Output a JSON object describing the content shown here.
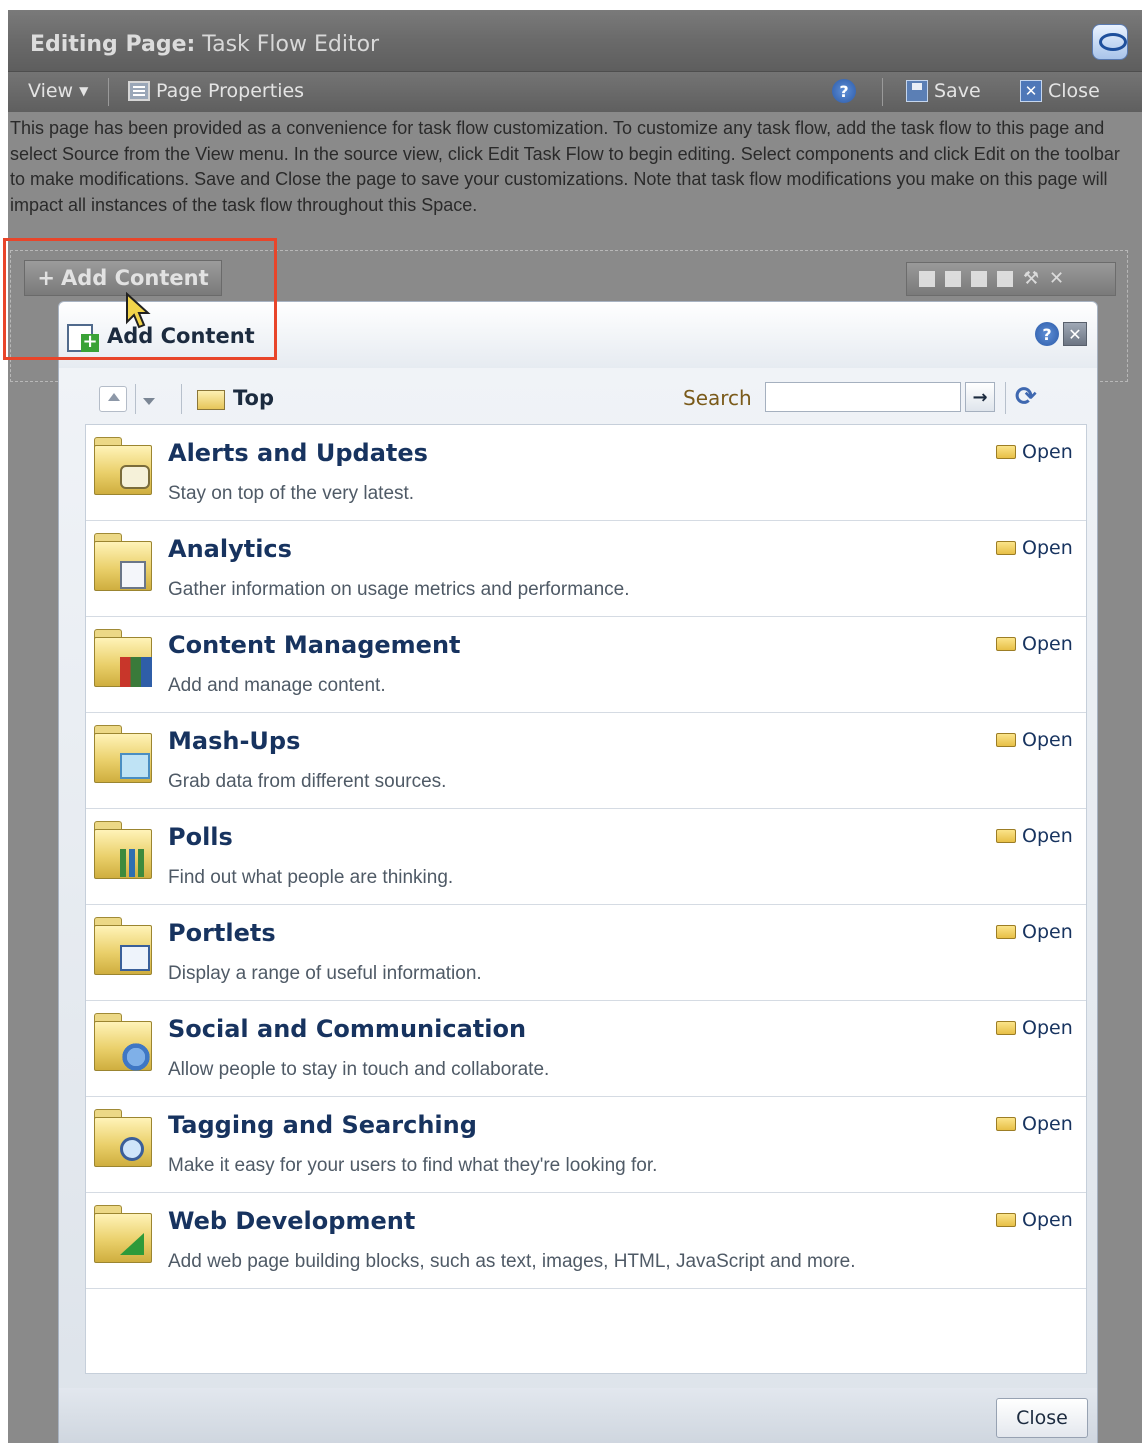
{
  "editor": {
    "title_prefix": "Editing Page:",
    "title_name": "Task Flow Editor",
    "menu": {
      "view": "View",
      "page_properties": "Page Properties",
      "save": "Save",
      "close": "Close"
    },
    "description": "This page has been provided as a convenience for task flow customization. To customize any task flow, add the task flow to this page and select Source from the View menu. In the source view, click Edit Task Flow to begin editing. Select components and click Edit on the toolbar to make modifications. Save and Close the page to save your customizations. Note that task flow modifications you make on this page will impact all instances of the task flow throughout this Space.",
    "add_content_button": "Add Content"
  },
  "dialog": {
    "title": "Add Content",
    "breadcrumb": "Top",
    "search_label": "Search",
    "search_value": "",
    "close_button": "Close",
    "items": [
      {
        "title": "Alerts and Updates",
        "desc": "Stay on top of the very latest.",
        "open": "Open",
        "icon": "alerts-folder-icon"
      },
      {
        "title": "Analytics",
        "desc": "Gather information on usage metrics and performance.",
        "open": "Open",
        "icon": "analytics-folder-icon"
      },
      {
        "title": "Content Management",
        "desc": "Add and manage content.",
        "open": "Open",
        "icon": "content-management-folder-icon"
      },
      {
        "title": "Mash-Ups",
        "desc": "Grab data from different sources.",
        "open": "Open",
        "icon": "mashups-folder-icon"
      },
      {
        "title": "Polls",
        "desc": "Find out what people are thinking.",
        "open": "Open",
        "icon": "polls-folder-icon"
      },
      {
        "title": "Portlets",
        "desc": "Display a range of useful information.",
        "open": "Open",
        "icon": "portlets-folder-icon"
      },
      {
        "title": "Social and Communication",
        "desc": "Allow people to stay in touch and collaborate.",
        "open": "Open",
        "icon": "social-folder-icon"
      },
      {
        "title": "Tagging and Searching",
        "desc": "Make it easy for your users to find what they're looking for.",
        "open": "Open",
        "icon": "tagging-folder-icon"
      },
      {
        "title": "Web Development",
        "desc": "Add web page building blocks, such as text, images, HTML, JavaScript and more.",
        "open": "Open",
        "icon": "web-development-folder-icon"
      }
    ]
  },
  "colors": {
    "highlight": "#e8452a",
    "link": "#17335f"
  }
}
